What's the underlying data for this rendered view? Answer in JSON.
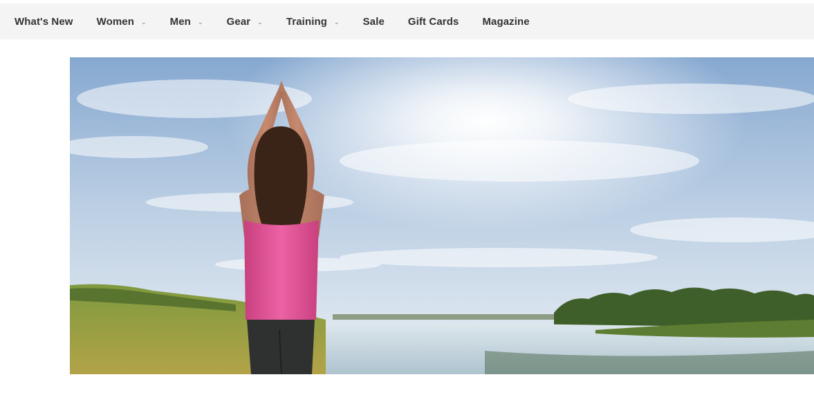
{
  "nav": {
    "items": [
      {
        "label": "What's New",
        "has_dropdown": false
      },
      {
        "label": "Women",
        "has_dropdown": true
      },
      {
        "label": "Men",
        "has_dropdown": true
      },
      {
        "label": "Gear",
        "has_dropdown": true
      },
      {
        "label": "Training",
        "has_dropdown": true
      },
      {
        "label": "Sale",
        "has_dropdown": false
      },
      {
        "label": "Gift Cards",
        "has_dropdown": false
      },
      {
        "label": "Magazine",
        "has_dropdown": false
      }
    ],
    "dropdown_icon": "chevron-down-icon",
    "dropdown_glyph": "⌄"
  },
  "hero": {
    "subject": "woman in pink tank top doing yoga pose by a lake at sunrise",
    "colors": {
      "sky_top": "#8fb0d6",
      "sky_bottom": "#e6eef4",
      "water": "#c9d8e2",
      "grass": "#7d9a3c",
      "tank_top": "#e4569a",
      "leggings": "#2e3130"
    }
  }
}
